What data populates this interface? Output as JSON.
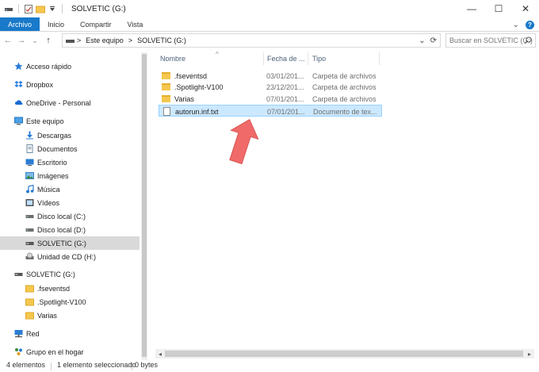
{
  "window": {
    "title": "SOLVETIC (G:)",
    "controls": {
      "minimize": "—",
      "maximize": "☐",
      "close": "✕"
    }
  },
  "ribbon": {
    "tabs": [
      "Archivo",
      "Inicio",
      "Compartir",
      "Vista"
    ],
    "active_tab": "Archivo",
    "expand_glyph": "⌄",
    "help_glyph": "?"
  },
  "addressbar": {
    "back": "←",
    "forward": "→",
    "recent": "⌄",
    "up": "↑",
    "breadcrumb": [
      "Este equipo",
      "SOLVETIC (G:)"
    ],
    "crumb_sep": ">",
    "dropdown_glyph": "⌄",
    "refresh_glyph": "⟳",
    "search_placeholder": "Buscar en SOLVETIC (G:)"
  },
  "nav": {
    "items": [
      {
        "label": "Acceso rápido",
        "icon": "star-icon"
      },
      {
        "label": "Dropbox",
        "icon": "dropbox-icon"
      },
      {
        "label": "OneDrive - Personal",
        "icon": "cloud-icon"
      },
      {
        "label": "Este equipo",
        "icon": "computer-icon"
      },
      {
        "label": "Descargas",
        "icon": "download-icon"
      },
      {
        "label": "Documentos",
        "icon": "documents-icon"
      },
      {
        "label": "Escritorio",
        "icon": "desktop-icon"
      },
      {
        "label": "Imágenes",
        "icon": "pictures-icon"
      },
      {
        "label": "Música",
        "icon": "music-icon"
      },
      {
        "label": "Vídeos",
        "icon": "videos-icon"
      },
      {
        "label": "Disco local (C:)",
        "icon": "drive-icon"
      },
      {
        "label": "Disco local (D:)",
        "icon": "drive-icon"
      },
      {
        "label": "SOLVETIC (G:)",
        "icon": "usb-drive-icon"
      },
      {
        "label": "Unidad de CD (H:)",
        "icon": "cd-drive-icon"
      },
      {
        "label": "SOLVETIC (G:)",
        "icon": "usb-drive-icon"
      },
      {
        "label": ".fseventsd",
        "icon": "folder-icon"
      },
      {
        "label": ".Spotlight-V100",
        "icon": "folder-icon"
      },
      {
        "label": "Varias",
        "icon": "folder-icon"
      },
      {
        "label": "Red",
        "icon": "network-icon"
      },
      {
        "label": "Grupo en el hogar",
        "icon": "homegroup-icon"
      }
    ],
    "selected": "SOLVETIC (G:)"
  },
  "columns": {
    "name": "Nombre",
    "date": "Fecha de ...",
    "type": "Tipo",
    "sort_glyph": "^"
  },
  "files": [
    {
      "name": ".fseventsd",
      "date": "03/01/201...",
      "type": "Carpeta de archivos",
      "kind": "folder"
    },
    {
      "name": ".Spotlight-V100",
      "date": "23/12/201...",
      "type": "Carpeta de archivos",
      "kind": "folder"
    },
    {
      "name": "Varias",
      "date": "07/01/201...",
      "type": "Carpeta de archivos",
      "kind": "folder"
    },
    {
      "name": "autorun.inf.txt",
      "date": "07/01/201...",
      "type": "Documento de tex...",
      "kind": "file",
      "selected": true
    }
  ],
  "status": {
    "count": "4 elementos",
    "selection": "1 elemento seleccionado",
    "size": "0 bytes"
  },
  "colors": {
    "accent": "#1979ca",
    "selection": "#cce8ff",
    "arrow": "#f06a6a"
  }
}
